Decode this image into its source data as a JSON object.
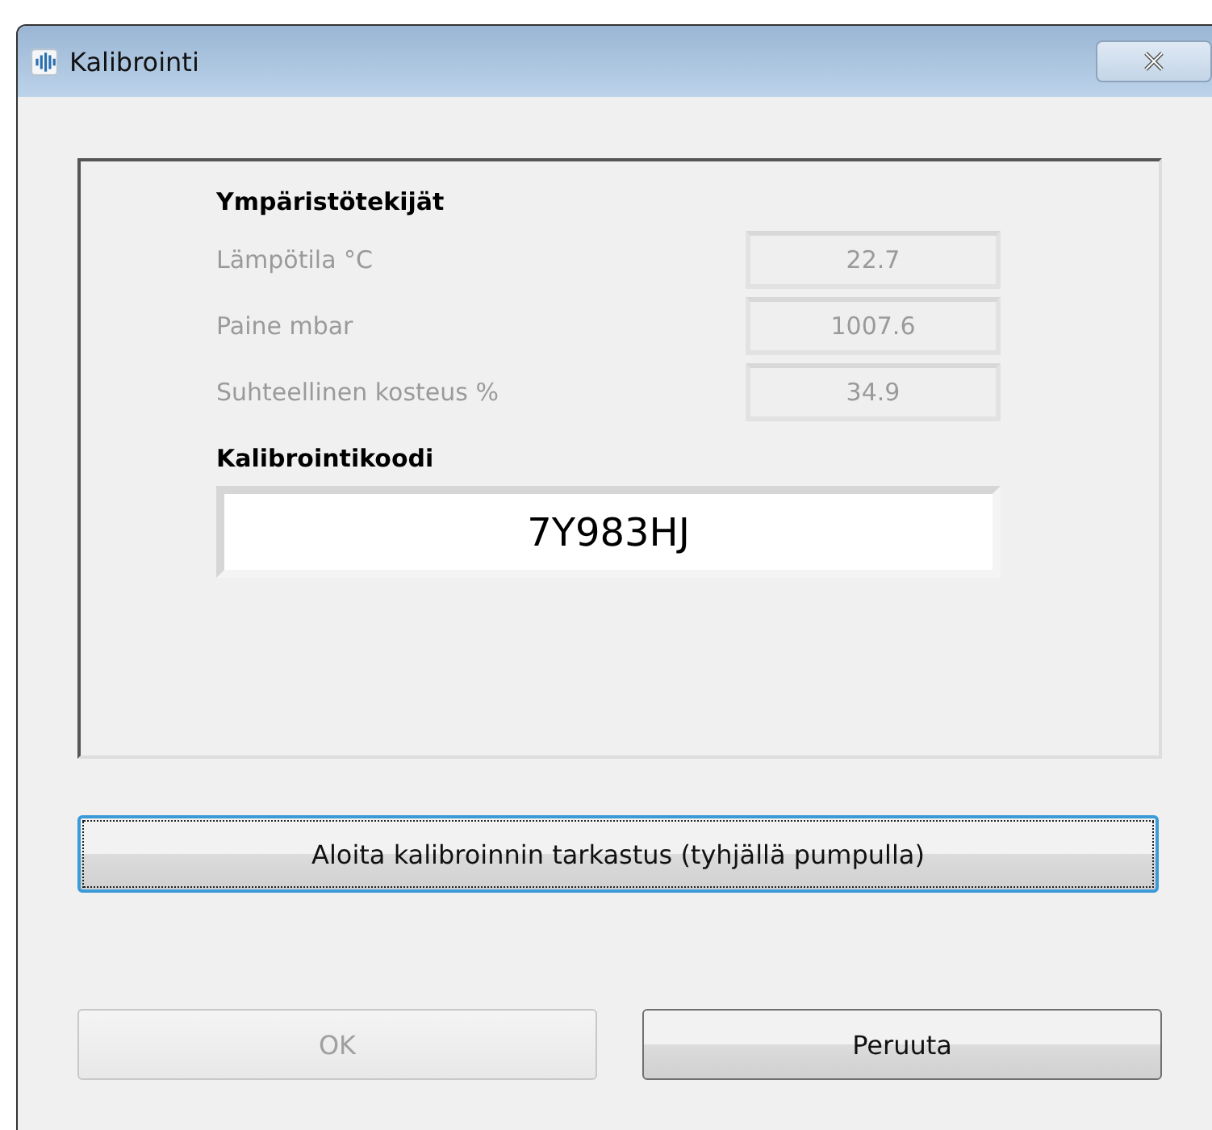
{
  "window": {
    "title": "Kalibrointi"
  },
  "environment": {
    "heading": "Ympäristötekijät",
    "disabled": true,
    "rows": [
      {
        "label": "Lämpötila °C",
        "value": "22.7"
      },
      {
        "label": "Paine mbar",
        "value": "1007.6"
      },
      {
        "label": "Suhteellinen kosteus %",
        "value": "34.9"
      }
    ]
  },
  "calibration": {
    "heading": "Kalibrointikoodi",
    "value": "7Y983HJ"
  },
  "check_button": {
    "label": "Aloita kalibroinnin tarkastus (tyhjällä pumpulla)",
    "focused": true
  },
  "buttons": [
    {
      "label": "OK",
      "disabled": true
    },
    {
      "label": "Peruuta",
      "disabled": false
    }
  ]
}
